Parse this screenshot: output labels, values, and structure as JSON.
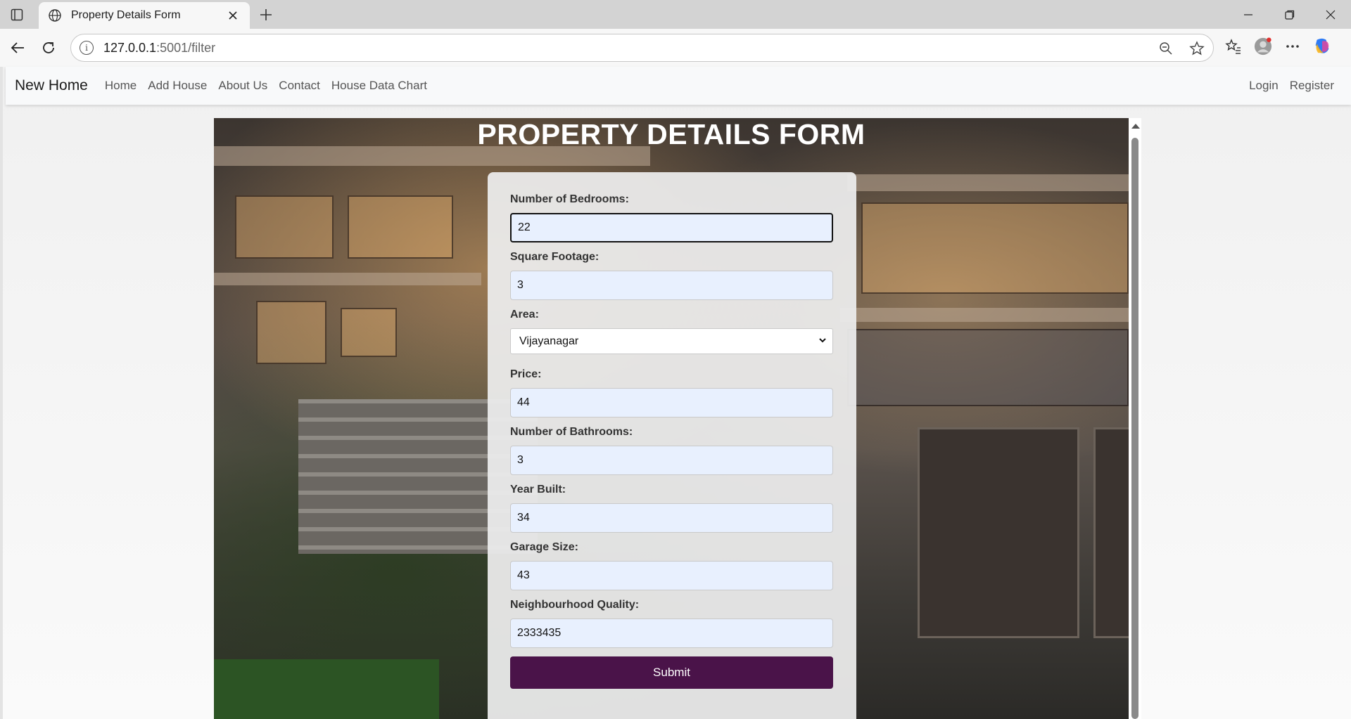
{
  "browser": {
    "tab_title": "Property Details Form",
    "url_host": "127.0.0.1",
    "url_path": ":5001/filter"
  },
  "nav": {
    "brand": "New Home",
    "links": [
      "Home",
      "Add House",
      "About Us",
      "Contact",
      "House Data Chart"
    ],
    "login": "Login",
    "register": "Register"
  },
  "form": {
    "title": "PROPERTY DETAILS FORM",
    "fields": [
      {
        "label": "Number of Bedrooms:",
        "value": "22"
      },
      {
        "label": "Square Footage:",
        "value": "3"
      },
      {
        "label": "Area:",
        "value": "Vijayanagar"
      },
      {
        "label": "Price:",
        "value": "44"
      },
      {
        "label": "Number of Bathrooms:",
        "value": "3"
      },
      {
        "label": "Year Built:",
        "value": "34"
      },
      {
        "label": "Garage Size:",
        "value": "43"
      },
      {
        "label": "Neighbourhood Quality:",
        "value": "2333435"
      }
    ],
    "submit": "Submit"
  },
  "colors": {
    "submit_bg": "#4a1349",
    "autofill_bg": "#e8f0fe"
  },
  "icons": [
    "sidebar-toggle-icon",
    "globe-icon",
    "close-icon",
    "new-tab-icon",
    "minimize-icon",
    "restore-icon",
    "window-close-icon",
    "back-icon",
    "refresh-icon",
    "site-info-icon",
    "zoom-out-icon",
    "favorite-star-icon",
    "favorites-icon",
    "profile-icon",
    "more-icon",
    "copilot-icon",
    "chevron-down-icon"
  ]
}
